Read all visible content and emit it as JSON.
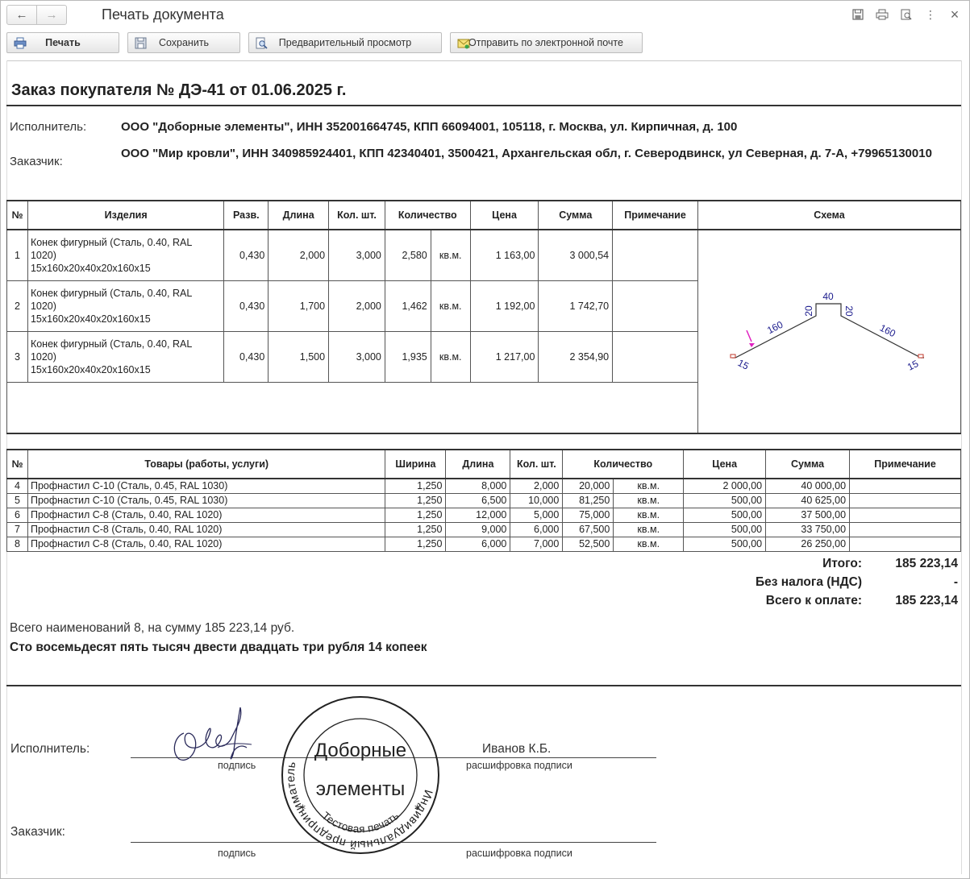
{
  "window": {
    "title": "Печать документа",
    "back_icon": "arrow-left-icon",
    "forward_icon": "arrow-right-icon",
    "close_glyph": "×"
  },
  "toolbar": {
    "print_label": "Печать",
    "save_label": "Сохранить",
    "preview_label": "Предварительный просмотр",
    "email_label": "Отправить по электронной почте"
  },
  "document": {
    "title": "Заказ покупателя № ДЭ-41 от 01.06.2025 г.",
    "executor_label": "Исполнитель:",
    "executor_value": "ООО \"Доборные элементы\", ИНН 352001664745, КПП 66094001, 105118, г. Москва, ул. Кирпичная, д. 100",
    "customer_label": "Заказчик:",
    "customer_value": "ООО \"Мир кровли\", ИНН 340985924401, КПП 42340401, 3500421, Архангельская обл, г. Северодвинск, ул Северная, д. 7-А, +79965130010"
  },
  "table1": {
    "headers": {
      "num": "№",
      "item": "Изделия",
      "razv": "Разв.",
      "length": "Длина",
      "pcs": "Кол. шт.",
      "qty": "Количество",
      "price": "Цена",
      "sum": "Сумма",
      "note": "Примечание",
      "scheme": "Схема"
    },
    "rows": [
      {
        "num": "1",
        "name1": "Конек фигурный (Сталь, 0.40, RAL",
        "name2": "1020)",
        "name3": "15х160х20х40х20х160х15",
        "razv": "0,430",
        "length": "2,000",
        "pcs": "3,000",
        "qty": "2,580",
        "unit": "кв.м.",
        "price": "1 163,00",
        "sum": "3 000,54",
        "note": ""
      },
      {
        "num": "2",
        "name1": "Конек фигурный (Сталь, 0.40, RAL",
        "name2": "1020)",
        "name3": "15х160х20х40х20х160х15",
        "razv": "0,430",
        "length": "1,700",
        "pcs": "2,000",
        "qty": "1,462",
        "unit": "кв.м.",
        "price": "1 192,00",
        "sum": "1 742,70",
        "note": ""
      },
      {
        "num": "3",
        "name1": "Конек фигурный (Сталь, 0.40, RAL",
        "name2": "1020)",
        "name3": "15х160х20х40х20х160х15",
        "razv": "0,430",
        "length": "1,500",
        "pcs": "3,000",
        "qty": "1,935",
        "unit": "кв.м.",
        "price": "1 217,00",
        "sum": "2 354,90",
        "note": ""
      }
    ],
    "scheme_labels": {
      "top": "40",
      "left_small": "20",
      "right_small": "20",
      "left_long": "160",
      "right_long": "160",
      "left_end": "15",
      "right_end": "15"
    }
  },
  "table2": {
    "headers": {
      "num": "№",
      "goods": "Товары (работы, услуги)",
      "width": "Ширина",
      "length": "Длина",
      "pcs": "Кол. шт.",
      "qty": "Количество",
      "price": "Цена",
      "sum": "Сумма",
      "note": "Примечание"
    },
    "rows": [
      {
        "num": "4",
        "name": "Профнастил С-10 (Сталь, 0.45, RAL 1030)",
        "width": "1,250",
        "length": "8,000",
        "pcs": "2,000",
        "qty": "20,000",
        "unit": "кв.м.",
        "price": "2 000,00",
        "sum": "40 000,00",
        "note": ""
      },
      {
        "num": "5",
        "name": "Профнастил С-10 (Сталь, 0.45, RAL 1030)",
        "width": "1,250",
        "length": "6,500",
        "pcs": "10,000",
        "qty": "81,250",
        "unit": "кв.м.",
        "price": "500,00",
        "sum": "40 625,00",
        "note": ""
      },
      {
        "num": "6",
        "name": "Профнастил С-8 (Сталь, 0.40, RAL 1020)",
        "width": "1,250",
        "length": "12,000",
        "pcs": "5,000",
        "qty": "75,000",
        "unit": "кв.м.",
        "price": "500,00",
        "sum": "37 500,00",
        "note": ""
      },
      {
        "num": "7",
        "name": "Профнастил С-8 (Сталь, 0.40, RAL 1020)",
        "width": "1,250",
        "length": "9,000",
        "pcs": "6,000",
        "qty": "67,500",
        "unit": "кв.м.",
        "price": "500,00",
        "sum": "33 750,00",
        "note": ""
      },
      {
        "num": "8",
        "name": "Профнастил С-8 (Сталь, 0.40, RAL 1020)",
        "width": "1,250",
        "length": "6,000",
        "pcs": "7,000",
        "qty": "52,500",
        "unit": "кв.м.",
        "price": "500,00",
        "sum": "26 250,00",
        "note": ""
      }
    ]
  },
  "totals": {
    "total_label": "Итого:",
    "total_value": "185 223,14",
    "vat_label": "Без налога (НДС)",
    "vat_value": "-",
    "grand_label": "Всего к оплате:",
    "grand_value": "185 223,14"
  },
  "summary": {
    "count_line": "Всего наименований 8, на сумму 185 223,14 руб.",
    "amount_words": "Сто восемьдесят пять тысяч двести двадцать три рубля 14 копеек"
  },
  "signatures": {
    "executor_label": "Исполнитель:",
    "customer_label": "Заказчик:",
    "signature_caption": "подпись",
    "decode_caption": "расшифровка подписи",
    "executor_name": "Иванов К.Б."
  },
  "stamp": {
    "ring_text": "Индивидуальный предприниматель",
    "bottom_text": "Тестовая печать",
    "line1": "Доборные",
    "line2": "элементы"
  },
  "colors": {
    "scheme_line": "#333333",
    "scheme_labels": "#1a1a8c",
    "scheme_arrow": "#e020c0",
    "scheme_end_mark": "#c0392b"
  }
}
